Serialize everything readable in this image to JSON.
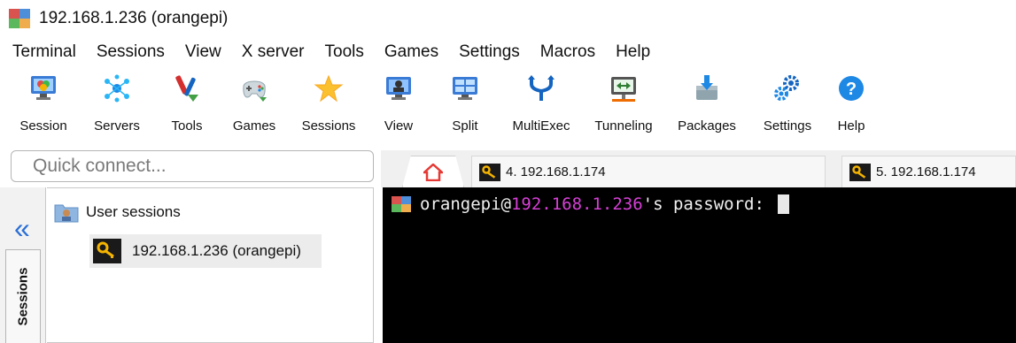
{
  "window": {
    "title": "192.168.1.236 (orangepi)",
    "app_icon": "mobaxterm-icon"
  },
  "menu": [
    "Terminal",
    "Sessions",
    "View",
    "X server",
    "Tools",
    "Games",
    "Settings",
    "Macros",
    "Help"
  ],
  "toolbar": [
    {
      "label": "Session",
      "icon": "session-icon"
    },
    {
      "label": "Servers",
      "icon": "servers-icon"
    },
    {
      "label": "Tools",
      "icon": "tools-icon"
    },
    {
      "label": "Games",
      "icon": "gamepad-icon"
    },
    {
      "label": "Sessions",
      "icon": "star-icon"
    },
    {
      "label": "View",
      "icon": "view-icon"
    },
    {
      "label": "Split",
      "icon": "split-icon"
    },
    {
      "label": "MultiExec",
      "icon": "multiexec-icon"
    },
    {
      "label": "Tunneling",
      "icon": "tunneling-icon"
    },
    {
      "label": "Packages",
      "icon": "packages-icon"
    },
    {
      "label": "Settings",
      "icon": "gears-icon"
    },
    {
      "label": "Help",
      "icon": "help-icon"
    }
  ],
  "quick_connect": {
    "placeholder": "Quick connect..."
  },
  "sidebar": {
    "collapse_glyph": "«",
    "vertical_tab": "Sessions",
    "tree": {
      "root_label": "User sessions",
      "children": [
        {
          "label": "192.168.1.236 (orangepi)",
          "icon": "key-icon",
          "selected": true
        }
      ]
    }
  },
  "tabs": [
    {
      "label": "4. 192.168.1.174",
      "icon": "key-icon"
    },
    {
      "label": "5. 192.168.1.174",
      "icon": "key-icon"
    }
  ],
  "terminal": {
    "user": "orangepi@",
    "host": "192.168.1.236",
    "suffix": "'s password: "
  },
  "colors": {
    "terminal_bg": "#000000",
    "terminal_fg": "#f0f0f0",
    "host_color": "#d640d6",
    "accent_blue": "#2a6fd6"
  }
}
